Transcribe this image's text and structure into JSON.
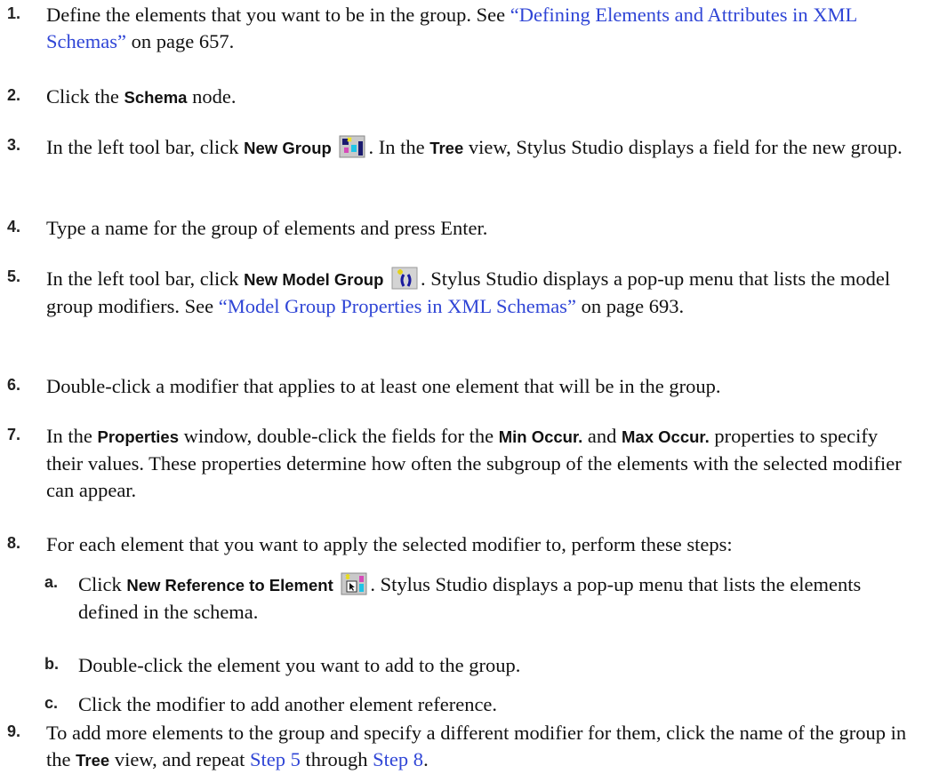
{
  "steps": {
    "s1": {
      "num": "1.",
      "a": "Define the elements that you want to be in the group. See ",
      "link": "“Defining Elements and Attributes in XML Schemas”",
      "b": " on page 657."
    },
    "s2": {
      "num": "2.",
      "a": "Click the ",
      "ui1": "Schema",
      "b": " node."
    },
    "s3": {
      "num": "3.",
      "a": "In the left tool bar, click ",
      "ui1": "New Group",
      "b": ". In the ",
      "ui2": "Tree",
      "c": " view, Stylus Studio displays a field for the new group."
    },
    "s4": {
      "num": "4.",
      "a": "Type a name for the group of elements and press Enter."
    },
    "s5": {
      "num": "5.",
      "a": "In the left tool bar, click ",
      "ui1": "New Model Group",
      "b": ". Stylus Studio displays a pop-up menu that lists the model group modifiers. See ",
      "link": "“Model Group Properties in XML Schemas”",
      "c": " on page 693."
    },
    "s6": {
      "num": "6.",
      "a": "Double-click a modifier that applies to at least one element that will be in the group."
    },
    "s7": {
      "num": "7.",
      "a": "In the ",
      "ui1": "Properties",
      "b": " window, double-click the fields for the ",
      "ui2": "Min Occur.",
      "c": " and ",
      "ui3": "Max Occur.",
      "d": " properties to specify their values. These properties determine how often the subgroup of the elements with the selected modifier can appear."
    },
    "s8": {
      "num": "8.",
      "a": "For each element that you want to apply the selected modifier to, perform these steps:"
    },
    "s8a": {
      "num": "a.",
      "a": "Click ",
      "ui1": "New Reference to Element",
      "b": ". Stylus Studio displays a pop-up menu that lists the elements defined in the schema."
    },
    "s8b": {
      "num": "b.",
      "a": "Double-click the element you want to add to the group."
    },
    "s8c": {
      "num": "c.",
      "a": "Click the modifier to add another element reference."
    },
    "s9": {
      "num": "9.",
      "a": "To add more elements to the group and specify a different modifier for them, click the name of the group in the ",
      "ui1": "Tree",
      "b": " view, and repeat ",
      "link1": "Step 5",
      "c": " through ",
      "link2": "Step 8",
      "d": "."
    }
  },
  "icons": {
    "new_group": "new-group-icon",
    "new_model_group": "new-model-group-icon",
    "new_reference": "new-reference-to-element-icon"
  },
  "colors": {
    "link": "#2f45d6",
    "text": "#111111"
  }
}
